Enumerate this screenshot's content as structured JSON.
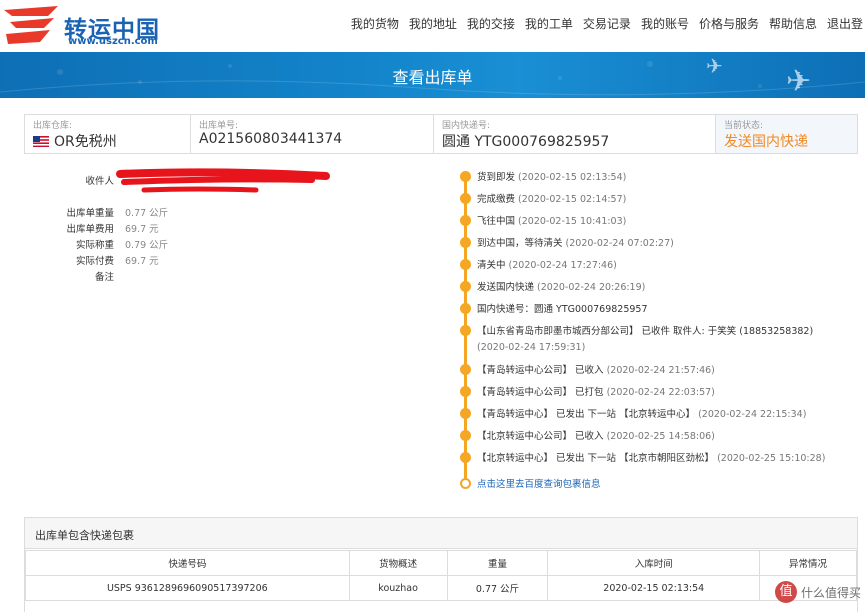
{
  "header": {
    "logo_cn": "转运中国",
    "logo_url": "www.uszcn.com",
    "nav": [
      "我的货物",
      "我的地址",
      "我的交接",
      "我的工单",
      "交易记录",
      "我的账号",
      "价格与服务",
      "帮助信息",
      "退出登"
    ]
  },
  "banner": {
    "title": "查看出库单"
  },
  "info": {
    "warehouse_label": "出库仓库:",
    "warehouse_value": "OR免税州",
    "order_label": "出库单号:",
    "order_value": "A021560803441374",
    "express_label": "国内快递号:",
    "express_value": "圆通 YTG000769825957",
    "status_label": "当前状态:",
    "status_value": "发送国内快递"
  },
  "detail": {
    "recipient_label": "收件人",
    "weight_label": "出库单重量",
    "weight_value": "0.77 公斤",
    "fee_label": "出库单费用",
    "fee_value": "69.7 元",
    "actual_weight_label": "实际称重",
    "actual_weight_value": "0.79 公斤",
    "paid_label": "实际付费",
    "paid_value": "69.7 元",
    "note_label": "备注"
  },
  "timeline": [
    {
      "text": "货到即发",
      "time": "(2020-02-15 02:13:54)"
    },
    {
      "text": "完成缴费",
      "time": "(2020-02-15 02:14:57)"
    },
    {
      "text": "飞往中国",
      "time": "(2020-02-15 10:41:03)"
    },
    {
      "text": "到达中国，等待清关",
      "time": "(2020-02-24 07:02:27)"
    },
    {
      "text": "清关中",
      "time": "(2020-02-24 17:27:46)"
    },
    {
      "text": "发送国内快递",
      "time": "(2020-02-24 20:26:19)"
    },
    {
      "text": "国内快递号：圆通 YTG000769825957",
      "time": ""
    },
    {
      "text": "【山东省青岛市即墨市城西分部公司】 已收件 取件人: 于笑笑 (18853258382)",
      "time": "(2020-02-24 17:59:31)"
    },
    {
      "text": "【青岛转运中心公司】 已收入",
      "time": "(2020-02-24 21:57:46)"
    },
    {
      "text": "【青岛转运中心公司】 已打包",
      "time": "(2020-02-24 22:03:57)"
    },
    {
      "text": "【青岛转运中心】 已发出 下一站 【北京转运中心】",
      "time": "(2020-02-24 22:15:34)"
    },
    {
      "text": "【北京转运中心公司】 已收入",
      "time": "(2020-02-25 14:58:06)"
    },
    {
      "text": "【北京转运中心】 已发出 下一站 【北京市朝阳区劲松】",
      "time": "(2020-02-25 15:10:28)"
    }
  ],
  "timeline_link": "点击这里去百度查询包裹信息",
  "packages": {
    "title": "出库单包含快递包裹",
    "headers": [
      "快递号码",
      "货物概述",
      "重量",
      "入库时间",
      "异常情况"
    ],
    "rows": [
      [
        "USPS 9361289696090517397206",
        "kouzhao",
        "0.77 公斤",
        "2020-02-15 02:13:54",
        ""
      ]
    ]
  },
  "watermark": "值 什么值得买",
  "colors": {
    "accent": "#f5a623",
    "brand": "#1a63b4",
    "banner": "#1486cc",
    "status": "#f08a24",
    "redaction": "#e8141b"
  }
}
